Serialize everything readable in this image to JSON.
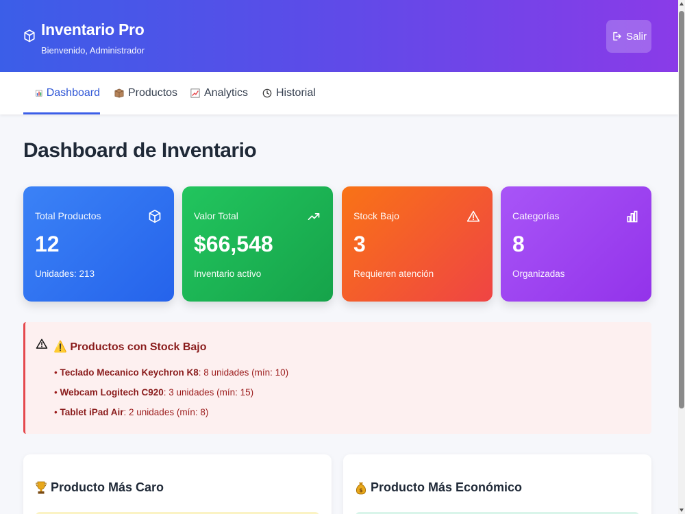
{
  "header": {
    "title": "Inventario Pro",
    "subtitle": "Bienvenido, Administrador",
    "logout_label": "Salir",
    "brand_icon": "cube-icon"
  },
  "nav": {
    "tabs": [
      {
        "label": "Dashboard",
        "icon": "bar-chart-icon",
        "active": true
      },
      {
        "label": "Productos",
        "icon": "box-icon",
        "active": false
      },
      {
        "label": "Analytics",
        "icon": "trend-chart-icon",
        "active": false
      },
      {
        "label": "Historial",
        "icon": "clock-icon",
        "active": false
      }
    ]
  },
  "main": {
    "title": "Dashboard de Inventario",
    "stats": [
      {
        "label": "Total Productos",
        "value": "12",
        "sub": "Unidades: 213",
        "icon": "cube-icon",
        "color": "#3b82f6"
      },
      {
        "label": "Valor Total",
        "value": "$66,548",
        "sub": "Inventario activo",
        "icon": "trending-up-icon",
        "color": "#22c55e"
      },
      {
        "label": "Stock Bajo",
        "value": "3",
        "sub": "Requieren atención",
        "icon": "warning-icon",
        "color": "#f97316"
      },
      {
        "label": "Categorías",
        "value": "8",
        "sub": "Organizadas",
        "icon": "bar-chart-icon",
        "color": "#a855f7"
      }
    ],
    "low_stock": {
      "title": "⚠️ Productos con Stock Bajo",
      "items": [
        {
          "name": "Teclado Mecanico Keychron K8",
          "detail": ": 8 unidades (mín: 10)"
        },
        {
          "name": "Webcam Logitech C920",
          "detail": ": 3 unidades (mín: 15)"
        },
        {
          "name": "Tablet iPad Air",
          "detail": ": 2 unidades (mín: 8)"
        }
      ]
    },
    "panels": [
      {
        "title": "Producto Más Caro",
        "icon": "trophy-icon"
      },
      {
        "title": "Producto Más Económico",
        "icon": "money-bag-icon"
      }
    ]
  }
}
